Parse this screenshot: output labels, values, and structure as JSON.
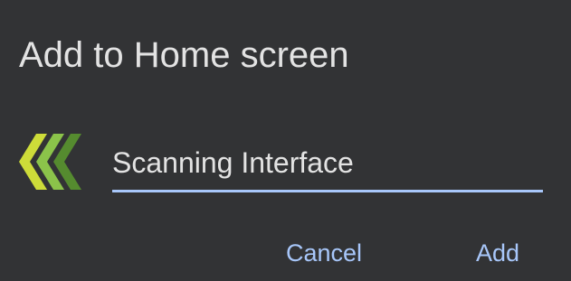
{
  "dialog": {
    "title": "Add to Home screen",
    "app_name_value": "Scanning Interface",
    "icon": "chevron-arrows-icon",
    "cancel_label": "Cancel",
    "add_label": "Add"
  },
  "colors": {
    "background": "#323335",
    "text": "#e3e3e3",
    "accent": "#a8c7fa",
    "icon_yellow_green": "#cddc39",
    "icon_light_green": "#8bc34a",
    "icon_green": "#558b2f"
  }
}
